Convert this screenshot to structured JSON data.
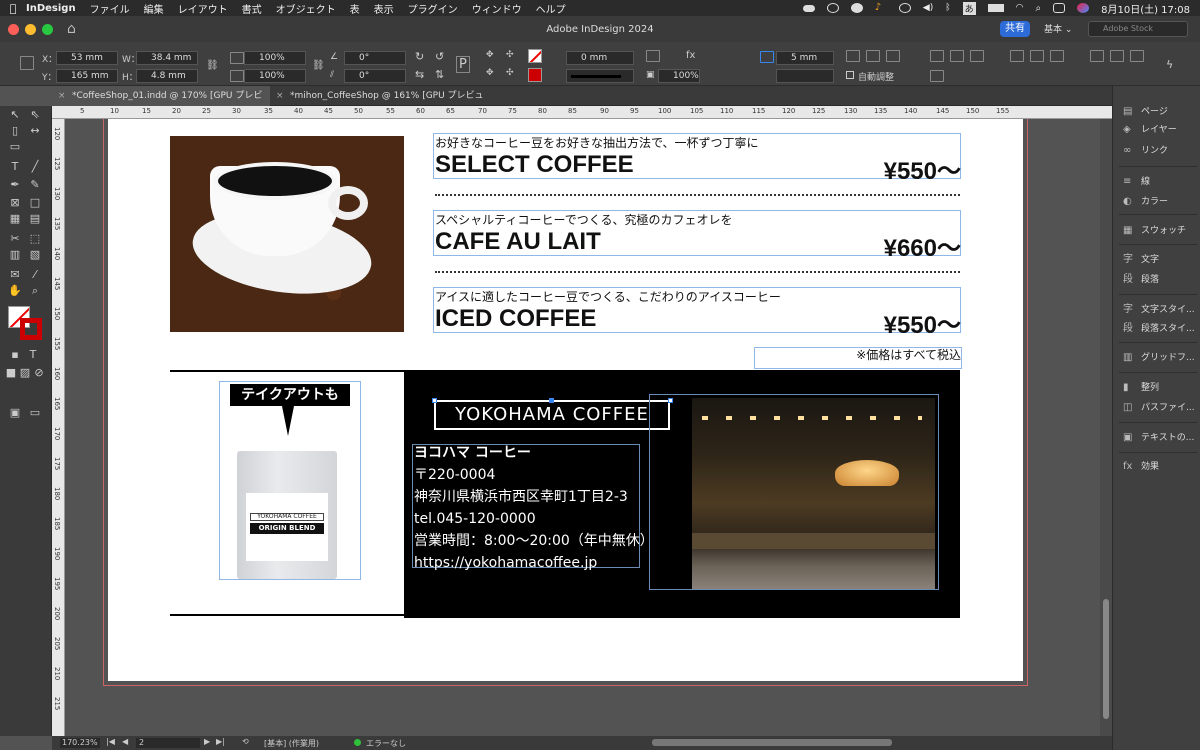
{
  "menubar": {
    "app": "InDesign",
    "items": [
      "ファイル",
      "編集",
      "レイアウト",
      "書式",
      "オブジェクト",
      "表",
      "表示",
      "プラグイン",
      "ウィンドウ",
      "ヘルプ"
    ],
    "ime": "あ",
    "datetime": "8月10日(土)  17:08"
  },
  "window": {
    "title": "Adobe InDesign 2024",
    "share_label": "共有",
    "workspace": "基本",
    "stock_placeholder": "Adobe Stock"
  },
  "control": {
    "x_label": "X：",
    "x_value": "53 mm",
    "y_label": "Y：",
    "y_value": "165 mm",
    "w_label": "W：",
    "w_value": "38.4 mm",
    "h_label": "H：",
    "h_value": "4.8 mm",
    "scale_x": "100%",
    "scale_y": "100%",
    "rotate": "0°",
    "shear": "0°",
    "stroke_weight": "0 mm",
    "opacity": "100%",
    "corner": "5 mm",
    "auto_fit": "自動調整"
  },
  "tabs": [
    {
      "label": "*CoffeeShop_01.indd @ 170% [GPU プレビュー]",
      "active": true
    },
    {
      "label": "*mihon_CoffeeShop @ 161% [GPU プレビュー]",
      "active": false
    }
  ],
  "ruler": {
    "h_ticks": [
      "5",
      "10",
      "15",
      "20",
      "25",
      "30",
      "35",
      "40",
      "45",
      "50",
      "55",
      "60",
      "65",
      "70",
      "75",
      "80",
      "85",
      "90",
      "95",
      "100",
      "105",
      "110",
      "115",
      "120",
      "125",
      "130",
      "135",
      "140",
      "145",
      "150",
      "155"
    ],
    "v_ticks": [
      "120",
      "125",
      "130",
      "135",
      "140",
      "145",
      "150",
      "155",
      "160",
      "165",
      "170",
      "175",
      "180",
      "185",
      "190",
      "195",
      "200",
      "205",
      "210",
      "215"
    ]
  },
  "document": {
    "items": [
      {
        "sub": "お好きなコーヒー豆をお好きな抽出方法で、一杯ずつ丁寧に",
        "name": "SELECT COFFEE",
        "price": "¥550〜"
      },
      {
        "sub": "スペシャルティコーヒーでつくる、究極のカフェオレを",
        "name": "CAFE AU LAIT",
        "price": "¥660〜"
      },
      {
        "sub": "アイスに適したコーヒー豆でつくる、こだわりのアイスコーヒー",
        "name": "ICED COFFEE",
        "price": "¥550〜"
      }
    ],
    "tax_note": "※価格はすべて税込",
    "takeout": "テイクアウトも",
    "bag_brand": "YOKOHAMA COFFEE",
    "bag_product": "ORIGIN BLEND",
    "logo": "YOKOHAMA COFFEE",
    "shop_name": "ヨコハマ コーヒー",
    "postal": "〒220-0004",
    "address": "神奈川県横浜市西区幸町1丁目2-3",
    "tel": "tel.045-120-0000",
    "hours": "営業時間：8:00〜20:00（年中無休）",
    "url": "https://yokohamacoffee.jp"
  },
  "panels": [
    {
      "icon": "pages-icon",
      "glyph": "▤",
      "label": "ページ"
    },
    {
      "icon": "layers-icon",
      "glyph": "◈",
      "label": "レイヤー"
    },
    {
      "icon": "links-icon",
      "glyph": "∞",
      "label": "リンク"
    },
    {
      "icon": "stroke-icon",
      "glyph": "≡",
      "label": "線"
    },
    {
      "icon": "color-icon",
      "glyph": "◐",
      "label": "カラー"
    },
    {
      "icon": "swatches-icon",
      "glyph": "▦",
      "label": "スウォッチ"
    },
    {
      "icon": "character-icon",
      "glyph": "字",
      "label": "文字"
    },
    {
      "icon": "paragraph-icon",
      "glyph": "段",
      "label": "段落"
    },
    {
      "icon": "char-styles-icon",
      "glyph": "字",
      "label": "文字スタイ..."
    },
    {
      "icon": "para-styles-icon",
      "glyph": "段",
      "label": "段落スタイ..."
    },
    {
      "icon": "grid-format-icon",
      "glyph": "▥",
      "label": "グリッドフ..."
    },
    {
      "icon": "align-icon",
      "glyph": "▮",
      "label": "整列"
    },
    {
      "icon": "pathfinder-icon",
      "glyph": "◫",
      "label": "パスファイ..."
    },
    {
      "icon": "text-wrap-icon",
      "glyph": "▣",
      "label": "テキストの..."
    },
    {
      "icon": "effects-icon",
      "glyph": "fx",
      "label": "効果"
    }
  ],
  "statusbar": {
    "zoom": "170.23%",
    "page": "2",
    "profile": "[基本] (作業用)",
    "preflight": "エラーなし"
  }
}
